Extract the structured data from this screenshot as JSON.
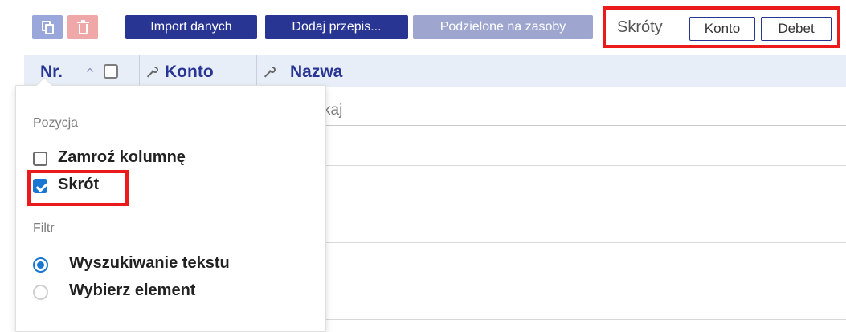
{
  "toolbar": {
    "copy_button_icon": "copy-icon",
    "delete_button_icon": "delete-icon",
    "import_label": "Import danych",
    "add_recipe_label": "Dodaj przepis...",
    "split_resources_label": "Podzielone na zasoby"
  },
  "shortcuts": {
    "label": "Skróty",
    "buttons": [
      "Konto",
      "Debet"
    ]
  },
  "grid": {
    "columns": [
      {
        "label": "Nr.",
        "sort_indicator": "sort-icon",
        "has_checkbox": true
      },
      {
        "label": "Konto",
        "icon": "wrench-icon"
      },
      {
        "label": "Nazwa",
        "icon": "wrench-icon"
      }
    ],
    "search_placeholder": "kaj"
  },
  "popup": {
    "position_section": "Pozycja",
    "freeze_column_label": "Zamroź kolumnę",
    "freeze_column_checked": false,
    "shortcut_label": "Skrót",
    "shortcut_checked": true,
    "filter_section": "Filtr",
    "filter_options": [
      {
        "label": "Wyszukiwanie tekstu",
        "selected": true
      },
      {
        "label": "Wybierz element",
        "selected": false
      }
    ]
  },
  "colors": {
    "primary_blue": "#283593",
    "disabled_blue": "#9ea6cf",
    "light_blue_icon": "#9aa7da",
    "light_red_icon": "#f0a7a7",
    "header_background": "#e8eef8",
    "highlight_red": "#ec1b1b",
    "checkbox_blue": "#1976d2"
  }
}
